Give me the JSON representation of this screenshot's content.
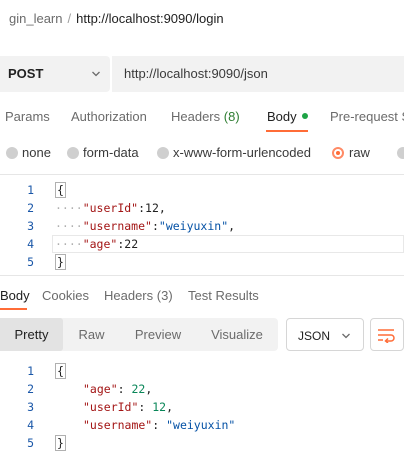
{
  "breadcrumb": {
    "collection": "gin_learn",
    "separator": "/",
    "request": "http://localhost:9090/login"
  },
  "request": {
    "method": "POST",
    "url": "http://localhost:9090/json"
  },
  "request_tabs": [
    {
      "label": "Params"
    },
    {
      "label": "Authorization"
    },
    {
      "label": "Headers",
      "count": "(8)"
    },
    {
      "label": "Body"
    },
    {
      "label": "Pre-request S"
    }
  ],
  "body_types": [
    "none",
    "form-data",
    "x-www-form-urlencoded",
    "raw",
    "b"
  ],
  "selected_body_type": "raw",
  "request_body": {
    "line_numbers": [
      "1",
      "2",
      "3",
      "4",
      "5"
    ],
    "open_brace": "{",
    "close_brace": "}",
    "indent": "····",
    "fields": [
      {
        "key": "\"userId\"",
        "sep": ":",
        "value": "12",
        "trail": ","
      },
      {
        "key": "\"username\"",
        "sep": ":",
        "value": "\"weiyuxin\"",
        "trail": ","
      },
      {
        "key": "\"age\"",
        "sep": ":",
        "value": "22",
        "trail": ""
      }
    ]
  },
  "response_tabs": [
    {
      "label": "Body"
    },
    {
      "label": "Cookies"
    },
    {
      "label": "Headers",
      "count": "(3)"
    },
    {
      "label": "Test Results"
    }
  ],
  "view_modes": [
    "Pretty",
    "Raw",
    "Preview",
    "Visualize"
  ],
  "active_view_mode": "Pretty",
  "response_format": "JSON",
  "response_body": {
    "line_numbers": [
      "1",
      "2",
      "3",
      "4",
      "5"
    ],
    "open_brace": "{",
    "close_brace": "}",
    "fields": [
      {
        "key": "\"age\"",
        "sep": ": ",
        "value": "22",
        "trail": ","
      },
      {
        "key": "\"userId\"",
        "sep": ": ",
        "value": "12",
        "trail": ","
      },
      {
        "key": "\"username\"",
        "sep": ": ",
        "value": "\"weiyuxin\"",
        "trail": ""
      }
    ]
  },
  "colors": {
    "accent": "#ff6c37",
    "active_dot": "#1ea446",
    "count": "#2e7d32",
    "json_key": "#a31515",
    "json_string": "#0451a5",
    "json_number": "#098658",
    "line_number": "#1a57a8"
  },
  "icons": {
    "method_dropdown": "chevron-down-icon",
    "format_dropdown": "chevron-down-icon",
    "wrap": "wrap-lines-icon"
  }
}
